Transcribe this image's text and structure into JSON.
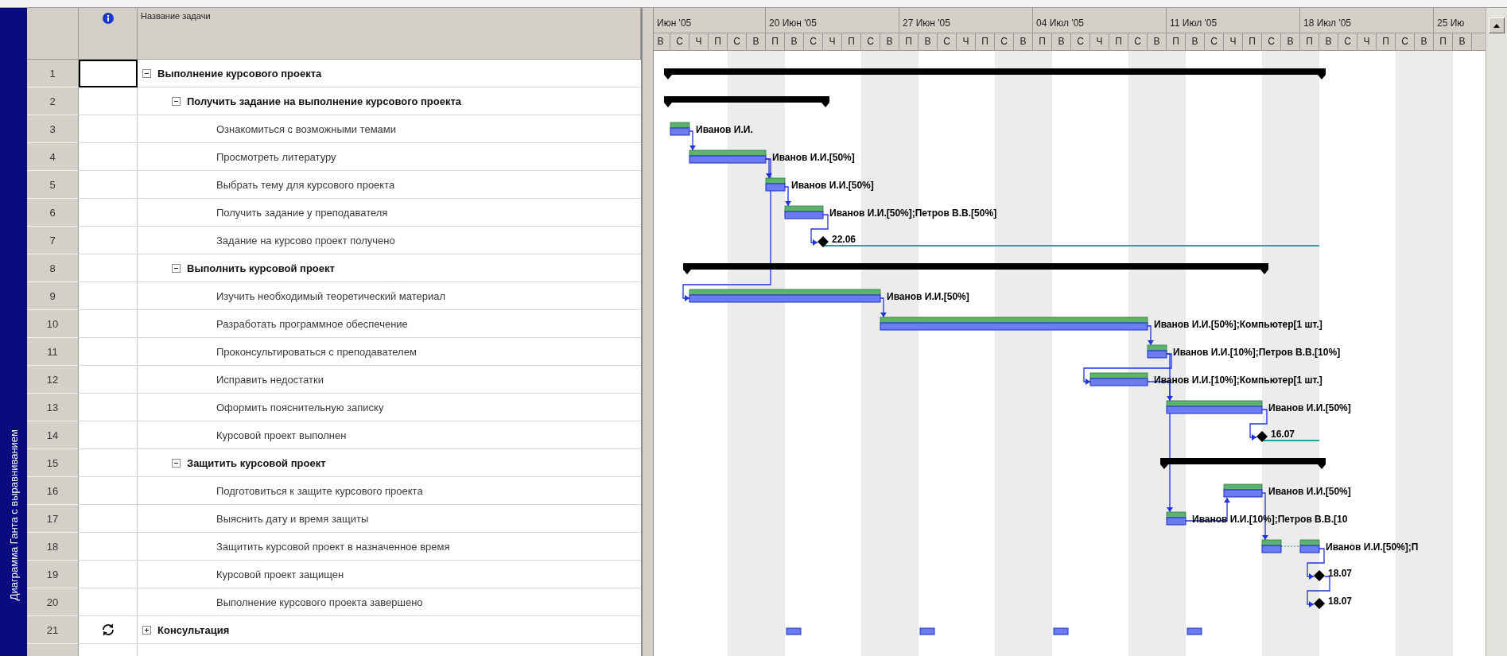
{
  "view_bar": {
    "title": "Диаграмма Ганта с выравниванием"
  },
  "table": {
    "name_column": "Название задачи"
  },
  "timescale": {
    "weeks": [
      "Июн '05",
      "20 Июн '05",
      "27 Июн '05",
      "04 Июл '05",
      "11 Июл '05",
      "18 Июл '05",
      "25 Ию"
    ],
    "days": [
      "В",
      "С",
      "Ч",
      "П",
      "С",
      "В",
      "П",
      "В",
      "С",
      "Ч",
      "П",
      "С",
      "В",
      "П",
      "В",
      "С",
      "Ч",
      "П",
      "С",
      "В",
      "П",
      "В",
      "С",
      "Ч",
      "П",
      "С",
      "В",
      "П",
      "В",
      "С",
      "Ч",
      "П",
      "С",
      "В",
      "П",
      "В",
      "С",
      "Ч",
      "П",
      "С",
      "В",
      "П",
      "В"
    ]
  },
  "tasks": [
    {
      "number": "1",
      "name": "Выполнение курсового проекта",
      "selected": true,
      "expanded": true,
      "bar": {
        "kind": "summary"
      },
      "children": [
        {
          "number": "2",
          "name": "Получить задание на выполнение курсового проекта",
          "selected": false,
          "expanded": true,
          "bar": {
            "kind": "summary"
          },
          "children": [
            {
              "number": "3",
              "name": "Ознакомиться с возможными темами",
              "selected": false,
              "bar": {
                "kind": "task",
                "label": "Иванов И.И."
              }
            },
            {
              "number": "4",
              "name": "Просмотреть литературу",
              "selected": false,
              "bar": {
                "kind": "task",
                "label": "Иванов И.И.[50%]"
              }
            },
            {
              "number": "5",
              "name": "Выбрать тему для курсового проекта",
              "selected": false,
              "bar": {
                "kind": "task",
                "label": "Иванов И.И.[50%]"
              }
            },
            {
              "number": "6",
              "name": "Получить задание у преподавателя",
              "selected": false,
              "bar": {
                "kind": "task",
                "label": "Иванов И.И.[50%];Петров В.В.[50%]"
              }
            },
            {
              "number": "7",
              "name": "Задание на курсово проект получено",
              "selected": false,
              "bar": {
                "kind": "milestone",
                "label": "22.06",
                "slack": true
              }
            }
          ]
        },
        {
          "number": "8",
          "name": "Выполнить курсовой проект",
          "selected": false,
          "expanded": true,
          "bar": {
            "kind": "summary"
          },
          "children": [
            {
              "number": "9",
              "name": "Изучить необходимый теоретический материал",
              "selected": false,
              "bar": {
                "kind": "task",
                "label": "Иванов И.И.[50%]"
              }
            },
            {
              "number": "10",
              "name": "Разработать программное обеспечение",
              "selected": false,
              "bar": {
                "kind": "task",
                "label": "Иванов И.И.[50%];Компьютер[1 шт.]"
              }
            },
            {
              "number": "11",
              "name": "Проконсультироваться с преподавателем",
              "selected": false,
              "bar": {
                "kind": "task",
                "label": "Иванов И.И.[10%];Петров В.В.[10%]"
              }
            },
            {
              "number": "12",
              "name": "Исправить недостатки",
              "selected": false,
              "bar": {
                "kind": "task",
                "label": "Иванов И.И.[10%];Компьютер[1 шт.]"
              }
            },
            {
              "number": "13",
              "name": "Оформить пояснительную записку",
              "selected": false,
              "bar": {
                "kind": "task",
                "label": "Иванов И.И.[50%]"
              }
            },
            {
              "number": "14",
              "name": "Курсовой проект выполнен",
              "selected": false,
              "bar": {
                "kind": "milestone",
                "label": "16.07",
                "slack": true
              }
            }
          ]
        },
        {
          "number": "15",
          "name": "Защитить курсовой проект",
          "selected": false,
          "expanded": true,
          "bar": {
            "kind": "summary"
          },
          "children": [
            {
              "number": "16",
              "name": "Подготовиться к защите курсового проекта",
              "selected": false,
              "bar": {
                "kind": "task",
                "label": "Иванов И.И.[50%]"
              }
            },
            {
              "number": "17",
              "name": "Выяснить дату и время защиты",
              "selected": false,
              "bar": {
                "kind": "task",
                "label": "Иванов И.И.[10%];Петров В.В.[10"
              }
            },
            {
              "number": "18",
              "name": "Защитить курсовой проект в назначенное время",
              "selected": false,
              "bar": {
                "kind": "split",
                "label": "Иванов И.И.[50%];П"
              }
            },
            {
              "number": "19",
              "name": "Курсовой проект защищен",
              "selected": false,
              "bar": {
                "kind": "milestone",
                "label": "18.07",
                "slack": false
              }
            },
            {
              "number": "20",
              "name": "Выполнение курсового проекта завершено",
              "selected": false,
              "bar": {
                "kind": "milestone",
                "label": "18.07",
                "slack": false
              }
            }
          ]
        }
      ]
    },
    {
      "number": "21",
      "name": "Консультация",
      "selected": false,
      "expanded": false,
      "indicator": {
        "kind": "recurring"
      },
      "bar": {
        "kind": "rollup"
      }
    }
  ]
}
